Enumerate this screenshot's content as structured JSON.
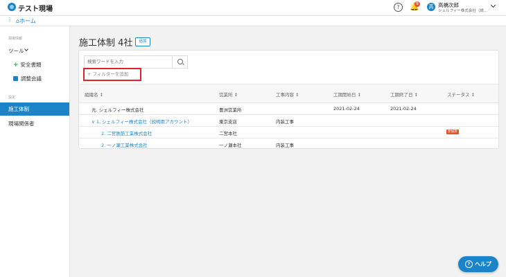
{
  "app": {
    "title": "テスト現場"
  },
  "header": {
    "help_icon": "?",
    "notification_count": "8",
    "avatar_initial": "高",
    "user_name": "高橋次郎",
    "user_company": "シェルフィー株式会社（説..."
  },
  "breadcrumb": {
    "dots": "⋮",
    "home": "ホーム"
  },
  "sidebar": {
    "section1": "現場情報",
    "tools_label": "ツール",
    "tool_items": [
      "安全書類",
      "調整会議"
    ],
    "section2": "設定",
    "nav_active": "施工体制",
    "nav_item": "現場関係者"
  },
  "main": {
    "title": "施工体制 4社",
    "add_button": "追加",
    "search_placeholder": "検索ワードを入力",
    "filter_button": "+ フィルターを追加",
    "columns": [
      "組織名 ↕",
      "営業所 ↕",
      "工事内容 ↕",
      "工期開始日 ↕",
      "工期終了日 ↕",
      "ステータス ↕"
    ],
    "rows": [
      {
        "name": "元. シェルフィー株式会社",
        "office": "豊洲営業所",
        "work": "",
        "start": "2021-02-24",
        "end": "2021-02-24",
        "status": ""
      },
      {
        "name": "∨ 1. シェルフィー株式会社（説明用アカウント）",
        "office": "東京支店",
        "work": "内装工事",
        "start": "",
        "end": "",
        "status": ""
      },
      {
        "name": "2. 二宮鉄筋工業株式会社",
        "office": "二宮本社",
        "work": "",
        "start": "",
        "end": "",
        "status": "参加済"
      },
      {
        "name": "2. 一ノ瀬工業株式会社",
        "office": "一ノ瀬本社",
        "work": "内装工事",
        "start": "",
        "end": "",
        "status": ""
      }
    ]
  },
  "help_fab": {
    "icon": "?",
    "label": "ヘルプ"
  },
  "colors": {
    "primary": "#1b84c9",
    "highlight": "#e0202a",
    "badge": "#e8542a",
    "tool_green": "#2fa84f"
  }
}
